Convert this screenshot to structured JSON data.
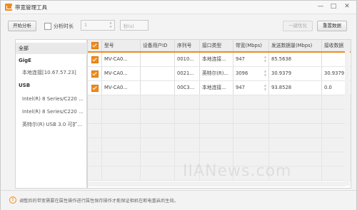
{
  "window": {
    "title": "带宽管理工具",
    "minimize": "—",
    "maximize": "□",
    "close": "✕"
  },
  "toolbar": {
    "start_label": "开始分析",
    "duration_label": "分析时长",
    "duration_value": "1",
    "unit_placeholder": "秒(s)",
    "optimize_label": "一键优化",
    "reset_label": "重置数据"
  },
  "tree": [
    {
      "label": "全部",
      "kind": "selected"
    },
    {
      "label": "GigE",
      "kind": "header"
    },
    {
      "label": "本地连接[10.67.57.23]",
      "kind": "child"
    },
    {
      "label": "USB",
      "kind": "header"
    },
    {
      "label": "Intel(R) 8 Series/C220 ...",
      "kind": "child"
    },
    {
      "label": "Intel(R) 8 Series/C220 ...",
      "kind": "child"
    },
    {
      "label": "英特尔(R) USB 3.0 可扩...",
      "kind": "child"
    }
  ],
  "table": {
    "columns": [
      "型号",
      "设备用户ID",
      "序列号",
      "接口类型",
      "带宽(Mbps)",
      "发送数据量(Mbps)",
      "接收数据"
    ],
    "rows": [
      {
        "model": "MV-CA0...",
        "user_id": "",
        "serial": "0010...",
        "interface": "本地连接...",
        "bandwidth": "947",
        "send": "85.5638",
        "recv": ""
      },
      {
        "model": "MV-CA0...",
        "user_id": "",
        "serial": "0021...",
        "interface": "英特尔(R)...",
        "bandwidth": "3096",
        "send": "30.9379",
        "recv": "30.9379"
      },
      {
        "model": "MV-CA0...",
        "user_id": "",
        "serial": "00C3...",
        "interface": "本地连接...",
        "bandwidth": "947",
        "send": "93.8528",
        "recv": "0.0"
      }
    ]
  },
  "watermark": "IIANews.com",
  "status": {
    "text": "调整后的带宽需要在属性操作进行属性保存操作才能保证相机在断电重启后生效。"
  },
  "colors": {
    "accent": "#f08a1d"
  }
}
